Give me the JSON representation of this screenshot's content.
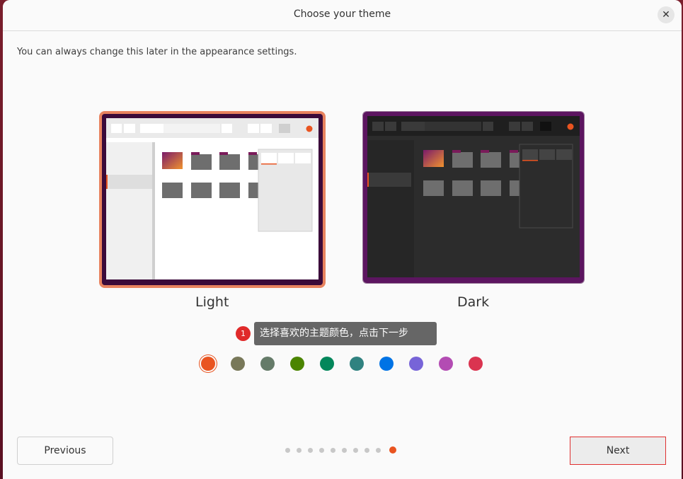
{
  "window": {
    "title": "Choose your theme",
    "close_icon": "close-icon"
  },
  "subtitle": "You can always change this later in the appearance settings.",
  "themes": [
    {
      "label": "Light",
      "selected": true
    },
    {
      "label": "Dark",
      "selected": false
    }
  ],
  "tooltip": {
    "step_number": "1",
    "text": "选择喜欢的主题颜色，点击下一步"
  },
  "accent_colors": [
    {
      "name": "orange",
      "hex": "#e95420",
      "selected": true
    },
    {
      "name": "bark",
      "hex": "#787859",
      "selected": false
    },
    {
      "name": "sage",
      "hex": "#657b69",
      "selected": false
    },
    {
      "name": "olive",
      "hex": "#4b8501",
      "selected": false
    },
    {
      "name": "viridian",
      "hex": "#03875b",
      "selected": false
    },
    {
      "name": "prussian-green",
      "hex": "#308280",
      "selected": false
    },
    {
      "name": "blue",
      "hex": "#0073e5",
      "selected": false
    },
    {
      "name": "purple",
      "hex": "#7764d8",
      "selected": false
    },
    {
      "name": "magenta",
      "hex": "#b34cb3",
      "selected": false
    },
    {
      "name": "red",
      "hex": "#da3450",
      "selected": false
    }
  ],
  "footer": {
    "previous_label": "Previous",
    "next_label": "Next",
    "total_steps": 10,
    "current_step": 10
  }
}
